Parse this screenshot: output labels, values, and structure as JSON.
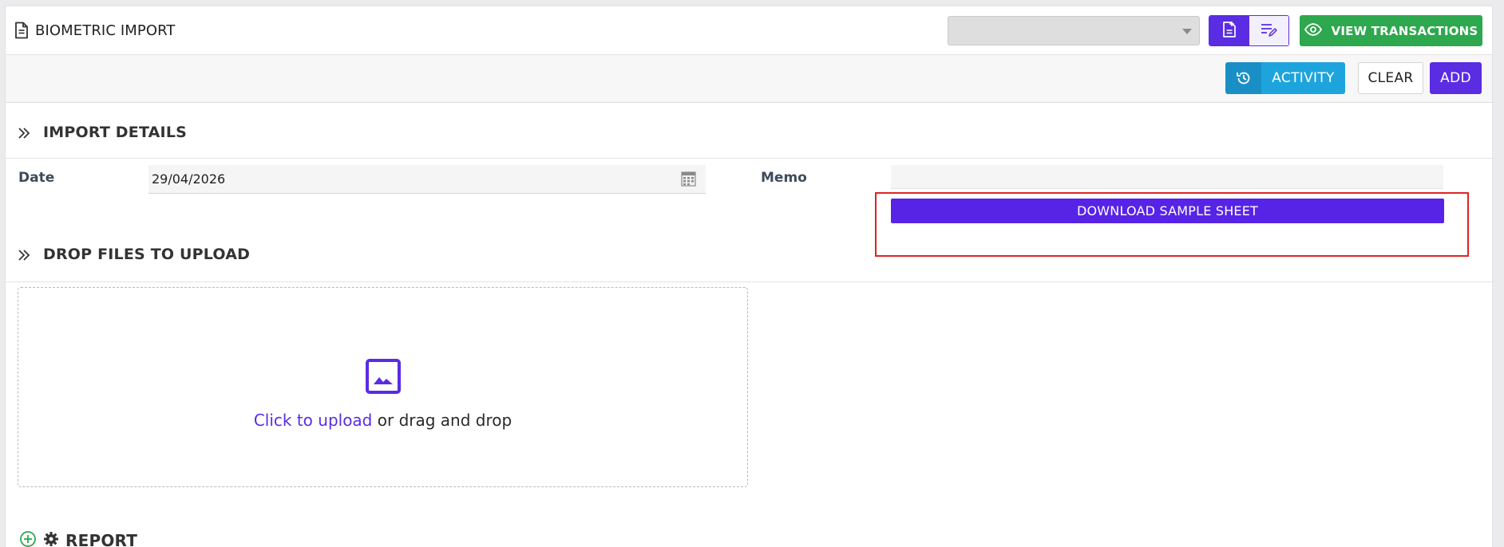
{
  "header": {
    "title": "BIOMETRIC IMPORT",
    "select_value": "",
    "view_transactions_label": "VIEW TRANSACTIONS"
  },
  "toolbar": {
    "activity_label": "ACTIVITY",
    "clear_label": "CLEAR",
    "add_label": "ADD"
  },
  "import_details": {
    "title": "IMPORT DETAILS",
    "date_label": "Date",
    "date_value": "29/04/2026",
    "memo_label": "Memo",
    "memo_value": "",
    "download_label": "DOWNLOAD SAMPLE SHEET"
  },
  "upload": {
    "title": "DROP FILES TO UPLOAD",
    "link_text": "Click to upload",
    "rest_text": " or drag and drop"
  },
  "report": {
    "title": "REPORT"
  },
  "colors": {
    "primary": "#5a2ce2",
    "success": "#2ea84e",
    "info": "#1ea4dd",
    "highlight": "#e02323"
  },
  "icons": [
    "document-icon",
    "new-document-icon",
    "edit-list-icon",
    "eye-icon",
    "history-icon",
    "double-chevron-right-icon",
    "calendar-icon",
    "image-icon",
    "plus-circle-icon",
    "gear-icon"
  ]
}
